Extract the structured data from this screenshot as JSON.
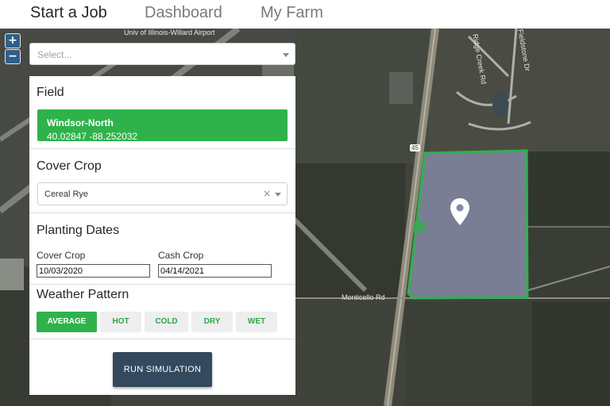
{
  "nav": {
    "tabs": [
      {
        "label": "Start a Job",
        "active": true
      },
      {
        "label": "Dashboard",
        "active": false
      },
      {
        "label": "My Farm",
        "active": false
      }
    ]
  },
  "map": {
    "zoom_in": "+",
    "zoom_out": "−",
    "search_placeholder": "Select...",
    "labels": {
      "airport": "Univ of Illinois-Willard Airport",
      "road": "Monticello Rd",
      "highway_shield": "45",
      "street_1": "Ridge Creek Rd",
      "street_2": "Fieldstone Dr"
    },
    "field_outline_color": "#2fb24c",
    "marker_icon": "map-pin-icon"
  },
  "panel": {
    "field": {
      "title": "Field",
      "name": "Windsor-North",
      "coords": "40.02847 -88.252032"
    },
    "cover_crop": {
      "title": "Cover Crop",
      "value": "Cereal Rye",
      "clear_symbol": "×"
    },
    "planting_dates": {
      "title": "Planting Dates",
      "cover_crop_label": "Cover Crop",
      "cover_crop_value": "10/03/2020",
      "cash_crop_label": "Cash Crop",
      "cash_crop_value": "04/14/2021"
    },
    "weather": {
      "title": "Weather Pattern",
      "options": [
        {
          "label": "AVERAGE",
          "active": true
        },
        {
          "label": "HOT",
          "active": false
        },
        {
          "label": "COLD",
          "active": false
        },
        {
          "label": "DRY",
          "active": false
        },
        {
          "label": "WET",
          "active": false
        }
      ]
    },
    "run_label": "RUN SIMULATION"
  },
  "colors": {
    "accent_green": "#2fb24c",
    "run_button": "#34495e",
    "zoom_button": "#2f5f8a"
  }
}
